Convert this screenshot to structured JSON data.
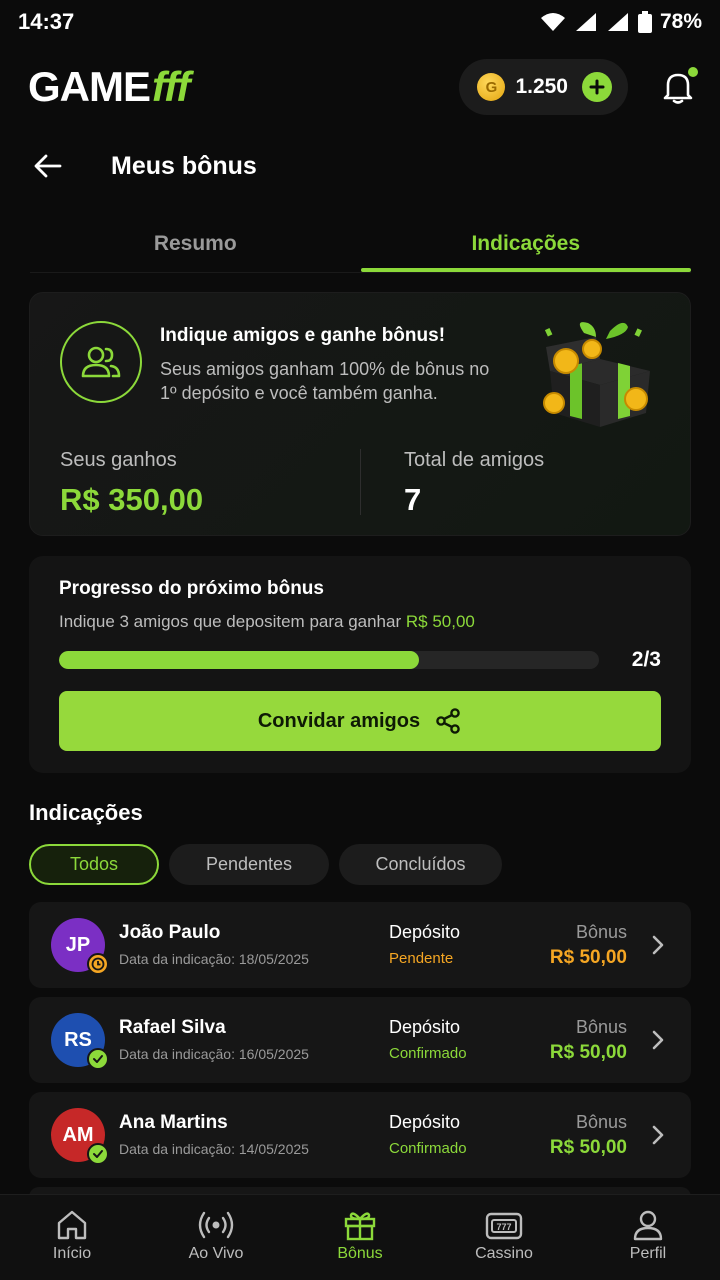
{
  "status_bar": {
    "time": "14:37",
    "battery": "78%"
  },
  "header": {
    "logo_main": "GAME",
    "logo_accent": "fff",
    "coins": "1.250"
  },
  "page": {
    "title": "Meus bônus"
  },
  "tabs": [
    {
      "label": "Resumo"
    },
    {
      "label": "Indicações"
    }
  ],
  "invite_card": {
    "title": "Indique amigos e ganhe bônus!",
    "description": "Seus amigos ganham 100% de bônus no 1º depósito e você também ganha.",
    "earnings_label": "Seus ganhos",
    "earnings_value": "R$ 350,00",
    "friends_label": "Total de amigos",
    "friends_value": "7"
  },
  "progress_card": {
    "title": "Progresso do próximo bônus",
    "description": "Indique 3 amigos que depositem para ganhar",
    "reward": "R$ 50,00",
    "count": "2/3",
    "progress_fraction": 0.6667,
    "button_label": "Convidar amigos"
  },
  "referrals_section": {
    "title": "Indicações",
    "filters": [
      {
        "label": "Todos"
      },
      {
        "label": "Pendentes"
      },
      {
        "label": "Concluídos"
      }
    ],
    "items": [
      {
        "initials": "JP",
        "name": "João Paulo",
        "date": "Data da indicação: 18/05/2025",
        "deposit_label": "Depósito",
        "deposit_status": "Pendente",
        "bonus_label": "Bônus",
        "bonus_value": "R$ 50,00"
      },
      {
        "initials": "RS",
        "name": "Rafael Silva",
        "date": "Data da indicação: 16/05/2025",
        "deposit_label": "Depósito",
        "deposit_status": "Confirmado",
        "bonus_label": "Bônus",
        "bonus_value": "R$ 50,00"
      },
      {
        "initials": "AM",
        "name": "Ana Martins",
        "date": "Data da indicação: 14/05/2025",
        "deposit_label": "Depósito",
        "deposit_status": "Confirmado",
        "bonus_label": "Bônus",
        "bonus_value": "R$ 50,00"
      }
    ]
  },
  "bottom_nav": [
    {
      "label": "Início",
      "icon": "home-icon"
    },
    {
      "label": "Ao Vivo",
      "icon": "live-icon"
    },
    {
      "label": "Bônus",
      "icon": "gift-icon"
    },
    {
      "label": "Cassino",
      "icon": "slot-machine-icon"
    },
    {
      "label": "Perfil",
      "icon": "user-icon"
    }
  ],
  "colors": {
    "accent": "#8cd93a",
    "pending": "#f5a623",
    "background": "#0b0b0b",
    "card": "#141414"
  }
}
